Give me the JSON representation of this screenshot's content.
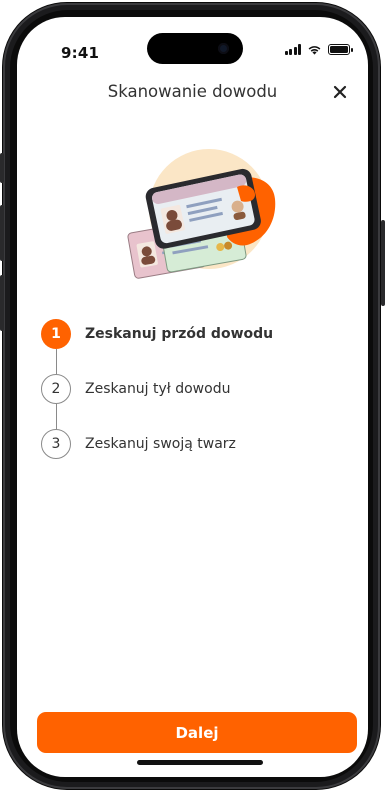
{
  "status_bar": {
    "time": "9:41",
    "icons": [
      "signal-icon",
      "wifi-icon",
      "battery-icon"
    ]
  },
  "header": {
    "title": "Skanowanie dowodu",
    "close_icon": "close-icon"
  },
  "steps": [
    {
      "number": "1",
      "label": "Zeskanuj przód dowodu",
      "state": "active"
    },
    {
      "number": "2",
      "label": "Zeskanuj tył dowodu",
      "state": "pending"
    },
    {
      "number": "3",
      "label": "Zeskanuj swoją twarz",
      "state": "pending"
    }
  ],
  "footer": {
    "next_label": "Dalej"
  },
  "colors": {
    "accent": "#ff6200",
    "text": "#333333",
    "step_border": "#8a8a8a"
  }
}
